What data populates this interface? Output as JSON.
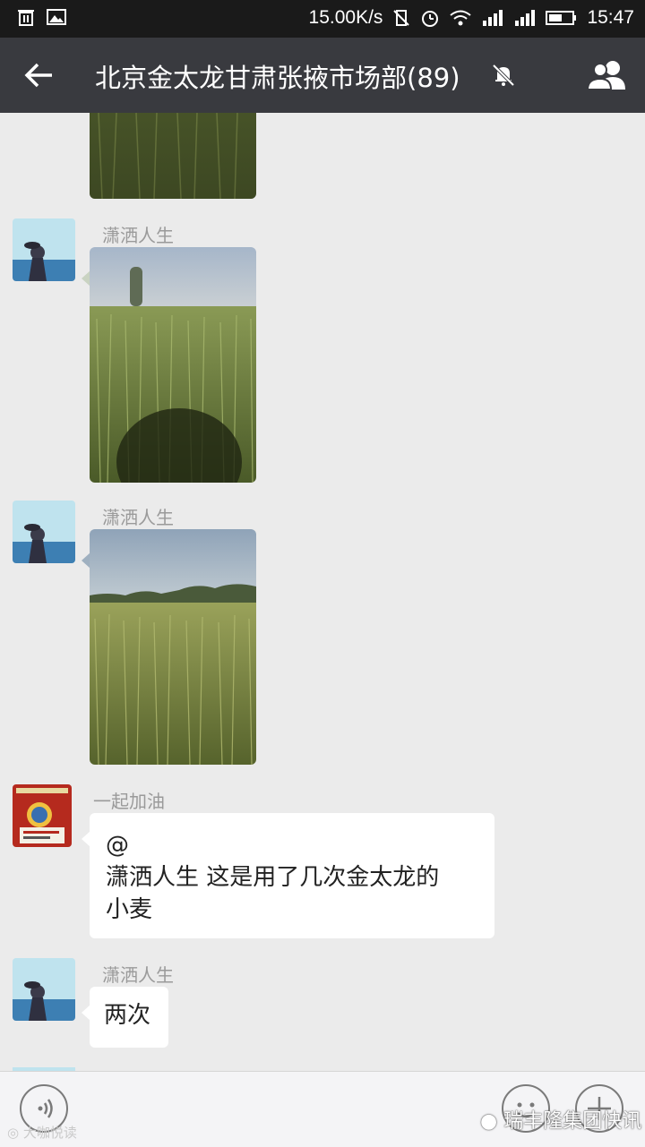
{
  "status_bar": {
    "speed": "15.00K/s",
    "time": "15:47"
  },
  "header": {
    "title": "北京金太龙甘肃张掖市场部(89)"
  },
  "messages": [
    {
      "sender": "潇洒人生",
      "type": "image"
    },
    {
      "sender": "潇洒人生",
      "type": "image"
    },
    {
      "sender": "一起加油",
      "type": "text",
      "lines": [
        "@",
        "潇洒人生 这是用了几次金太龙的",
        "小麦"
      ]
    },
    {
      "sender": "潇洒人生",
      "type": "text",
      "lines": [
        "两次"
      ]
    }
  ],
  "watermarks": {
    "left": "大咖悦读",
    "right": "瑞丰隆集团快讯"
  },
  "colors": {
    "titlebar": "#393a3f",
    "background": "#ebebeb",
    "bubble": "#ffffff",
    "statusbar": "#1a1a1a"
  }
}
